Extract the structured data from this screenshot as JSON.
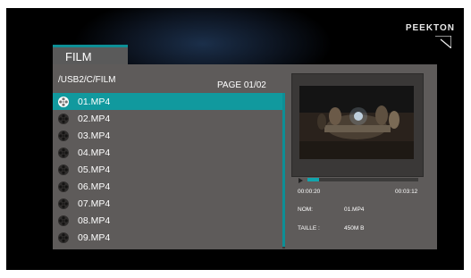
{
  "brand": {
    "name": "PEEKTON"
  },
  "tab": {
    "label": "FILM"
  },
  "browser": {
    "path": "/USB2/C/FILM",
    "page": "PAGE 01/02",
    "selected_index": 0,
    "files": [
      "01.MP4",
      "02.MP4",
      "03.MP4",
      "04.MP4",
      "05.MP4",
      "06.MP4",
      "07.MP4",
      "08.MP4",
      "09.MP4"
    ]
  },
  "player": {
    "current_time": "00:00:20",
    "total_time": "00:03:12",
    "progress_fraction": 0.104
  },
  "info": {
    "name_label": "NOM:",
    "name_value": "01.MP4",
    "size_label": "TAILLE :",
    "size_value": "450M B"
  },
  "colors": {
    "accent": "#11999e",
    "panel": "#5e5b5a"
  }
}
